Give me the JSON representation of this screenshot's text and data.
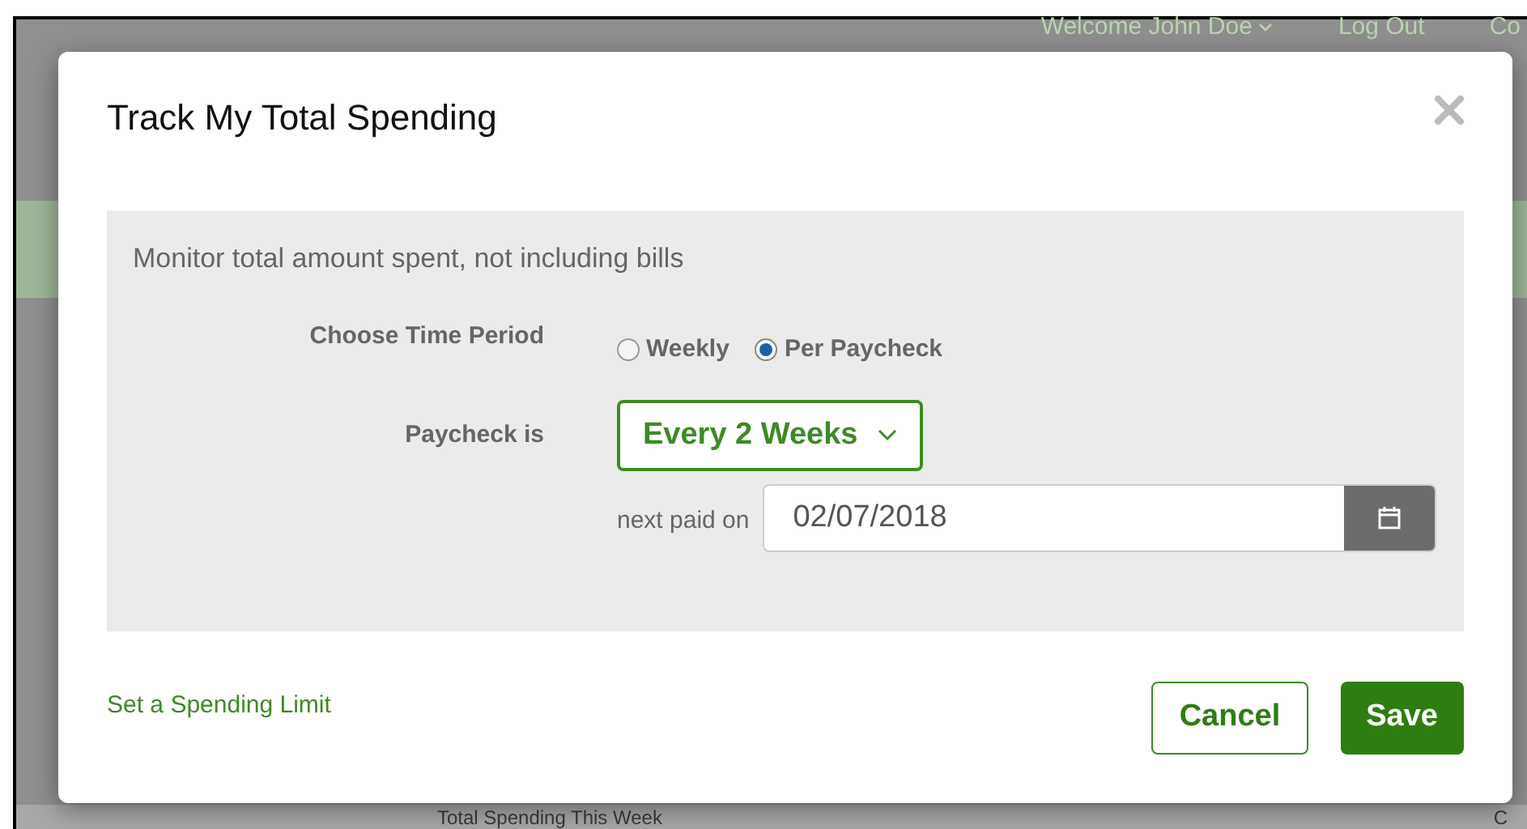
{
  "background": {
    "header_links": [
      {
        "label": "Welcome John Doe",
        "has_menu": true
      },
      {
        "label": "Log Out",
        "has_menu": false
      },
      {
        "label": "Co",
        "has_menu": false
      }
    ],
    "table_headers": [
      "Total Spending This Week",
      "C"
    ]
  },
  "dialog": {
    "title": "Track My Total Spending",
    "description": "Monitor total amount spent, not including bills",
    "time_period": {
      "label": "Choose Time Period",
      "options": [
        {
          "label": "Weekly",
          "selected": false
        },
        {
          "label": "Per Paycheck",
          "selected": true
        }
      ]
    },
    "paycheck": {
      "label": "Paycheck is",
      "value": "Every 2 Weeks"
    },
    "next_paid": {
      "label": "next paid on",
      "value": "02/07/2018"
    },
    "link": "Set a Spending Limit",
    "buttons": [
      {
        "label": "Cancel",
        "kind": "secondary"
      },
      {
        "label": "Save",
        "kind": "primary"
      }
    ]
  }
}
